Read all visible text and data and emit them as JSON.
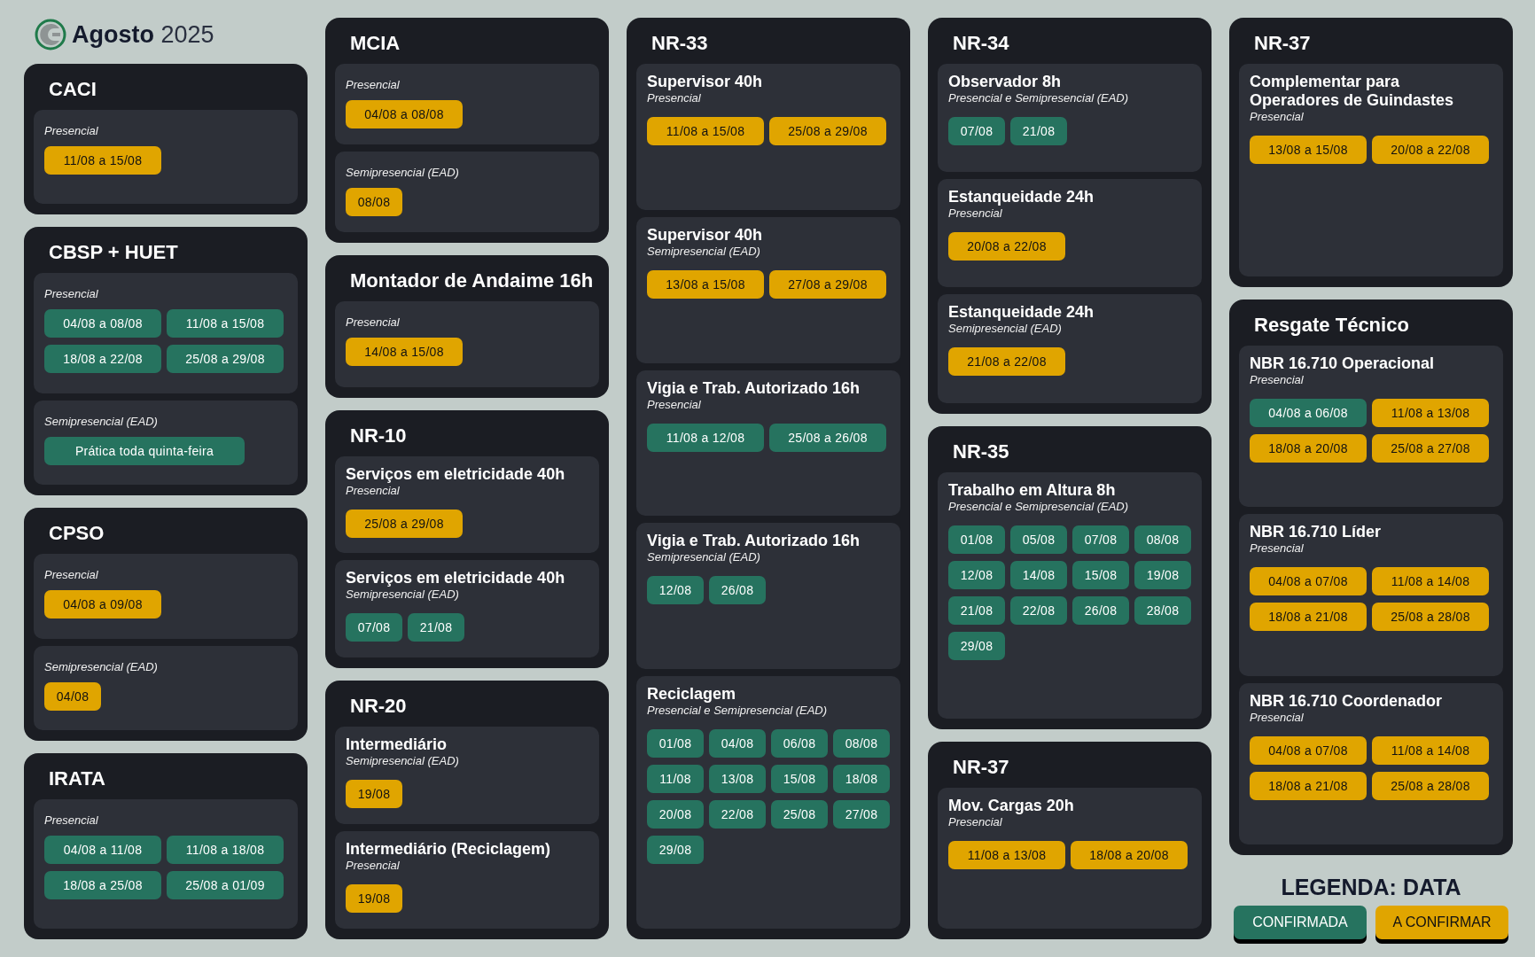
{
  "header": {
    "month": "Agosto",
    "year": "2025"
  },
  "columns": [
    {
      "cards": [
        {
          "title": "CACI",
          "sections": [
            {
              "mode": "Presencial",
              "dates": [
                {
                  "text": "11/08 a 15/08",
                  "confirmed": false
                }
              ]
            }
          ]
        },
        {
          "title": "CBSP + HUET",
          "sections": [
            {
              "mode": "Presencial",
              "dates": [
                {
                  "text": "04/08 a 08/08",
                  "confirmed": true
                },
                {
                  "text": "11/08 a 15/08",
                  "confirmed": true
                },
                {
                  "text": "18/08 a 22/08",
                  "confirmed": true
                },
                {
                  "text": "25/08 a 29/08",
                  "confirmed": true
                }
              ]
            },
            {
              "mode": "Semipresencial (EAD)",
              "dates": [
                {
                  "text": "Prática toda quinta-feira",
                  "confirmed": true
                }
              ]
            }
          ]
        },
        {
          "title": "CPSO",
          "sections": [
            {
              "mode": "Presencial",
              "dates": [
                {
                  "text": "04/08 a 09/08",
                  "confirmed": false
                }
              ]
            },
            {
              "mode": "Semipresencial (EAD)",
              "dates": [
                {
                  "text": "04/08",
                  "confirmed": false
                }
              ]
            }
          ]
        },
        {
          "title": "IRATA",
          "sections": [
            {
              "mode": "Presencial",
              "dates": [
                {
                  "text": "04/08 a 11/08",
                  "confirmed": true
                },
                {
                  "text": "11/08 a 18/08",
                  "confirmed": true
                },
                {
                  "text": "18/08 a 25/08",
                  "confirmed": true
                },
                {
                  "text": "25/08 a 01/09",
                  "confirmed": true
                }
              ]
            }
          ]
        }
      ]
    },
    {
      "cards": [
        {
          "title": "MCIA",
          "sections": [
            {
              "mode": "Presencial",
              "dates": [
                {
                  "text": "04/08 a 08/08",
                  "confirmed": false
                }
              ]
            },
            {
              "mode": "Semipresencial (EAD)",
              "dates": [
                {
                  "text": "08/08",
                  "confirmed": false
                }
              ]
            }
          ]
        },
        {
          "title": "Montador de Andaime 16h",
          "sections": [
            {
              "mode": "Presencial",
              "dates": [
                {
                  "text": "14/08 a 15/08",
                  "confirmed": false
                }
              ]
            }
          ]
        },
        {
          "title": "NR-10",
          "sections": [
            {
              "title": "Serviços em eletricidade 40h",
              "mode": "Presencial",
              "dates": [
                {
                  "text": "25/08 a 29/08",
                  "confirmed": false
                }
              ]
            },
            {
              "title": "Serviços em eletricidade 40h",
              "mode": "Semipresencial (EAD)",
              "dates": [
                {
                  "text": "07/08",
                  "confirmed": true
                },
                {
                  "text": "21/08",
                  "confirmed": true
                }
              ]
            }
          ]
        },
        {
          "title": "NR-20",
          "sections": [
            {
              "title": "Intermediário",
              "mode": "Semipresencial (EAD)",
              "dates": [
                {
                  "text": "19/08",
                  "confirmed": false
                }
              ]
            },
            {
              "title": "Intermediário (Reciclagem)",
              "mode": "Presencial",
              "dates": [
                {
                  "text": "19/08",
                  "confirmed": false
                }
              ]
            }
          ]
        }
      ]
    },
    {
      "cards": [
        {
          "title": "NR-33",
          "sections": [
            {
              "title": "Supervisor 40h",
              "mode": "Presencial",
              "dates": [
                {
                  "text": "11/08 a 15/08",
                  "confirmed": false
                },
                {
                  "text": "25/08 a 29/08",
                  "confirmed": false
                }
              ]
            },
            {
              "title": "Supervisor 40h",
              "mode": "Semipresencial (EAD)",
              "dates": [
                {
                  "text": "13/08 a 15/08",
                  "confirmed": false
                },
                {
                  "text": "27/08 a 29/08",
                  "confirmed": false
                }
              ]
            },
            {
              "title": "Vigia e Trab. Autorizado 16h",
              "mode": "Presencial",
              "dates": [
                {
                  "text": "11/08 a 12/08",
                  "confirmed": true
                },
                {
                  "text": "25/08 a 26/08",
                  "confirmed": true
                }
              ]
            },
            {
              "title": "Vigia e Trab. Autorizado 16h",
              "mode": "Semipresencial (EAD)",
              "dates": [
                {
                  "text": "12/08",
                  "confirmed": true
                },
                {
                  "text": "26/08",
                  "confirmed": true
                }
              ]
            },
            {
              "title": "Reciclagem",
              "mode": "Presencial e Semipresencial (EAD)",
              "dates": [
                {
                  "text": "01/08",
                  "confirmed": true
                },
                {
                  "text": "04/08",
                  "confirmed": true
                },
                {
                  "text": "06/08",
                  "confirmed": true
                },
                {
                  "text": "08/08",
                  "confirmed": true
                },
                {
                  "text": "11/08",
                  "confirmed": true
                },
                {
                  "text": "13/08",
                  "confirmed": true
                },
                {
                  "text": "15/08",
                  "confirmed": true
                },
                {
                  "text": "18/08",
                  "confirmed": true
                },
                {
                  "text": "20/08",
                  "confirmed": true
                },
                {
                  "text": "22/08",
                  "confirmed": true
                },
                {
                  "text": "25/08",
                  "confirmed": true
                },
                {
                  "text": "27/08",
                  "confirmed": true
                },
                {
                  "text": "29/08",
                  "confirmed": true
                }
              ]
            }
          ]
        }
      ]
    },
    {
      "cards": [
        {
          "title": "NR-34",
          "sections": [
            {
              "title": "Observador 8h",
              "mode": "Presencial e Semipresencial (EAD)",
              "dates": [
                {
                  "text": "07/08",
                  "confirmed": true
                },
                {
                  "text": "21/08",
                  "confirmed": true
                }
              ]
            },
            {
              "title": "Estanqueidade 24h",
              "mode": "Presencial",
              "dates": [
                {
                  "text": "20/08 a 22/08",
                  "confirmed": false
                }
              ]
            },
            {
              "title": "Estanqueidade 24h",
              "mode": "Semipresencial (EAD)",
              "dates": [
                {
                  "text": "21/08 a 22/08",
                  "confirmed": false
                }
              ]
            }
          ]
        },
        {
          "title": "NR-35",
          "sections": [
            {
              "title": "Trabalho em Altura 8h",
              "mode": "Presencial e Semipresencial (EAD)",
              "dates": [
                {
                  "text": "01/08",
                  "confirmed": true
                },
                {
                  "text": "05/08",
                  "confirmed": true
                },
                {
                  "text": "07/08",
                  "confirmed": true
                },
                {
                  "text": "08/08",
                  "confirmed": true
                },
                {
                  "text": "12/08",
                  "confirmed": true
                },
                {
                  "text": "14/08",
                  "confirmed": true
                },
                {
                  "text": "15/08",
                  "confirmed": true
                },
                {
                  "text": "19/08",
                  "confirmed": true
                },
                {
                  "text": "21/08",
                  "confirmed": true
                },
                {
                  "text": "22/08",
                  "confirmed": true
                },
                {
                  "text": "26/08",
                  "confirmed": true
                },
                {
                  "text": "28/08",
                  "confirmed": true
                },
                {
                  "text": "29/08",
                  "confirmed": true
                }
              ]
            }
          ]
        },
        {
          "title": "NR-37",
          "sections": [
            {
              "title": "Mov. Cargas 20h",
              "mode": "Presencial",
              "dates": [
                {
                  "text": "11/08 a 13/08",
                  "confirmed": false
                },
                {
                  "text": "18/08 a 20/08",
                  "confirmed": false
                }
              ]
            }
          ]
        }
      ]
    },
    {
      "cards": [
        {
          "title": "NR-37",
          "sections": [
            {
              "title": "Complementar para Operadores de Guindastes",
              "mode": "Presencial",
              "dates": [
                {
                  "text": "13/08 a 15/08",
                  "confirmed": false
                },
                {
                  "text": "20/08 a 22/08",
                  "confirmed": false
                }
              ]
            }
          ]
        },
        {
          "title": "Resgate Técnico",
          "sections": [
            {
              "title": "NBR 16.710 Operacional",
              "mode": "Presencial",
              "dates": [
                {
                  "text": "04/08 a 06/08",
                  "confirmed": true
                },
                {
                  "text": "11/08 a 13/08",
                  "confirmed": false
                },
                {
                  "text": "18/08 a 20/08",
                  "confirmed": false
                },
                {
                  "text": "25/08 a 27/08",
                  "confirmed": false
                }
              ]
            },
            {
              "title": "NBR 16.710 Líder",
              "mode": "Presencial",
              "dates": [
                {
                  "text": "04/08 a 07/08",
                  "confirmed": false
                },
                {
                  "text": "11/08 a 14/08",
                  "confirmed": false
                },
                {
                  "text": "18/08 a 21/08",
                  "confirmed": false
                },
                {
                  "text": "25/08 a 28/08",
                  "confirmed": false
                }
              ]
            },
            {
              "title": "NBR 16.710 Coordenador",
              "mode": "Presencial",
              "dates": [
                {
                  "text": "04/08 a 07/08",
                  "confirmed": false
                },
                {
                  "text": "11/08 a 14/08",
                  "confirmed": false
                },
                {
                  "text": "18/08 a 21/08",
                  "confirmed": false
                },
                {
                  "text": "25/08 a 28/08",
                  "confirmed": false
                }
              ]
            }
          ]
        }
      ]
    }
  ],
  "legend": {
    "title": "LEGENDA: DATA",
    "items": [
      {
        "label": "CONFIRMADA",
        "confirmed": true
      },
      {
        "label": "A CONFIRMAR",
        "confirmed": false
      }
    ]
  }
}
